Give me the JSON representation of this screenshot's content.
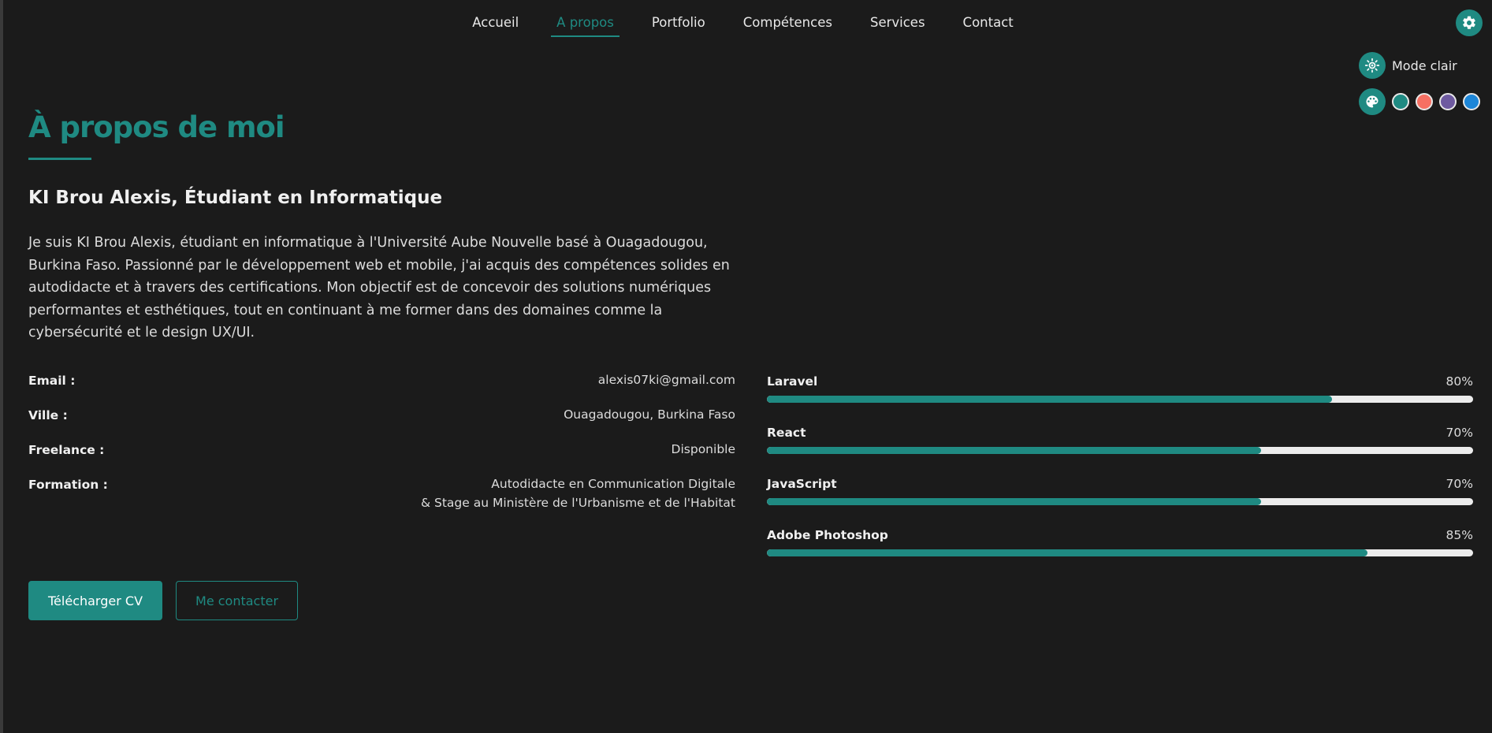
{
  "nav": {
    "items": [
      {
        "label": "Accueil"
      },
      {
        "label": "A propos"
      },
      {
        "label": "Portfolio"
      },
      {
        "label": "Compétences"
      },
      {
        "label": "Services"
      },
      {
        "label": "Contact"
      }
    ],
    "active": "A propos"
  },
  "settings": {
    "gear_icon": "gear-icon",
    "mode_label": "Mode clair",
    "mode_icon": "sun-icon",
    "palette_icon": "palette-icon",
    "colors": [
      "#1f8a82",
      "#f77063",
      "#6e5aa0",
      "#1d86d8"
    ]
  },
  "about": {
    "title": "À propos de moi",
    "subtitle": "KI Brou Alexis, Étudiant en Informatique",
    "bio": "Je suis KI Brou Alexis, étudiant en informatique à l'Université Aube Nouvelle basé à Ouagadougou, Burkina Faso. Passionné par le développement web et mobile, j'ai acquis des compétences solides en autodidacte et à travers des certifications. Mon objectif est de concevoir des solutions numériques performantes et esthétiques, tout en continuant à me former dans des domaines comme la cybersécurité et le design UX/UI."
  },
  "info": [
    {
      "key": "Email :",
      "value": "alexis07ki@gmail.com",
      "value2": ""
    },
    {
      "key": "Ville :",
      "value": "Ouagadougou, Burkina Faso",
      "value2": ""
    },
    {
      "key": "Freelance :",
      "value": "Disponible",
      "value2": ""
    },
    {
      "key": "Formation :",
      "value": "Autodidacte en Communication Digitale",
      "value2": "& Stage au Ministère de l'Urbanisme et de l'Habitat"
    }
  ],
  "skills": [
    {
      "name": "Laravel",
      "percent": "80%",
      "level": 0.8
    },
    {
      "name": "React",
      "percent": "70%",
      "level": 0.7
    },
    {
      "name": "JavaScript",
      "percent": "70%",
      "level": 0.7
    },
    {
      "name": "Adobe Photoshop",
      "percent": "85%",
      "level": 0.85
    }
  ],
  "buttons": {
    "download": "Télécharger CV",
    "contact": "Me contacter"
  },
  "colors": {
    "accent": "#1f8a82",
    "background": "#1b1b1b"
  }
}
